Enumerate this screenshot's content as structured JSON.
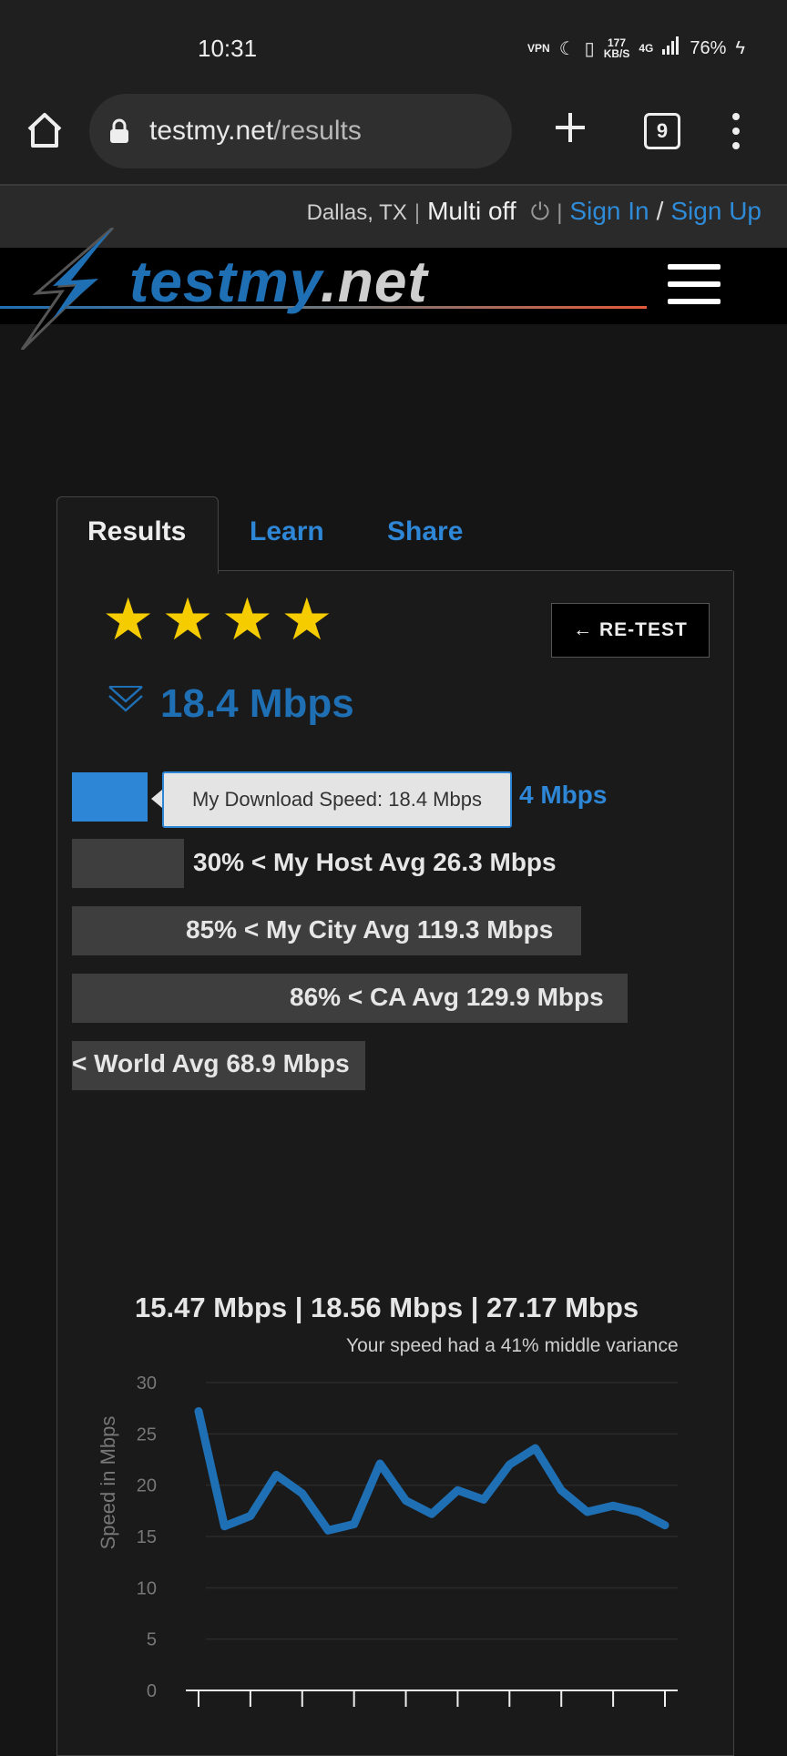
{
  "status_bar": {
    "time": "10:31",
    "vpn": "VPN",
    "net_speed_value": "177",
    "net_speed_unit": "KB/S",
    "network": "4G",
    "battery": "76%"
  },
  "browser": {
    "url_domain": "testmy.net",
    "url_path": "/results",
    "tab_count": "9"
  },
  "site_top": {
    "location": "Dallas, TX",
    "separator": "|",
    "multi": "Multi off",
    "power_icon": "power-icon",
    "sign_in": "Sign In",
    "slash": "/",
    "sign_up": "Sign Up"
  },
  "logo": {
    "main": "testmy",
    "suffix": ".net"
  },
  "tabs": {
    "results": "Results",
    "learn": "Learn",
    "share": "Share"
  },
  "rating": {
    "stars": 4,
    "max": 4
  },
  "retest": {
    "label": "← RE-TEST"
  },
  "main_speed": "18.4 Mbps",
  "comparison_bars": [
    {
      "label": "My Download Speed: 18.4 Mbps",
      "value": 18.4,
      "visible_suffix": "4 Mbps"
    },
    {
      "label": "30% < My Host Avg 26.3 Mbps",
      "value": 26.3
    },
    {
      "label": "85% < My City Avg 119.3 Mbps",
      "value": 119.3
    },
    {
      "label": "86% < CA Avg 129.9 Mbps",
      "value": 129.9
    },
    {
      "label": "< World Avg 68.9 Mbps",
      "value": 68.9
    }
  ],
  "tooltip": "My Download Speed: 18.4 Mbps",
  "stats_line": "15.47 Mbps | 18.56 Mbps | 27.17 Mbps",
  "variance_text": "Your speed had a 41% middle variance",
  "chart_data": {
    "type": "line",
    "ylabel": "Speed in Mbps",
    "ylim": [
      0,
      30
    ],
    "yticks": [
      0,
      5,
      10,
      15,
      20,
      25,
      30
    ],
    "grid": true,
    "color": "#1f6fb4",
    "x": [
      0,
      1,
      2,
      3,
      4,
      5,
      6,
      7,
      8,
      9,
      10,
      11,
      12,
      13,
      14,
      15,
      16,
      17,
      18
    ],
    "values": [
      27.2,
      16,
      17,
      21,
      19.2,
      15.6,
      16.2,
      22.1,
      18.5,
      17.2,
      19.5,
      18.6,
      22,
      23.6,
      19.5,
      17.4,
      18,
      17.4,
      16.1
    ]
  }
}
